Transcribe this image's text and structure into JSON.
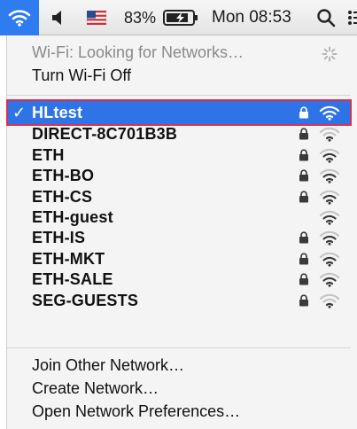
{
  "menubar": {
    "wifi_icon": "wifi-icon",
    "sound_icon": "speaker-icon",
    "flag_icon": "us-flag-icon",
    "battery_percent": "83%",
    "battery_icon": "battery-charging-icon",
    "clock": "Mon 08:53",
    "search_icon": "magnifier-icon",
    "notification_icon": "list-icon",
    "colors": {
      "wifi_active_bg": "#2f7bf0"
    }
  },
  "menu": {
    "status": "Wi-Fi: Looking for Networks…",
    "toggle": "Turn Wi-Fi Off",
    "networks": [
      {
        "name": "HLtest",
        "selected": true,
        "locked": true,
        "signal_bars": 4
      },
      {
        "name": "DIRECT-8C701B3B",
        "selected": false,
        "locked": true,
        "signal_bars": 2
      },
      {
        "name": "ETH",
        "selected": false,
        "locked": true,
        "signal_bars": 3
      },
      {
        "name": "ETH-BO",
        "selected": false,
        "locked": true,
        "signal_bars": 3
      },
      {
        "name": "ETH-CS",
        "selected": false,
        "locked": true,
        "signal_bars": 3
      },
      {
        "name": "ETH-guest",
        "selected": false,
        "locked": false,
        "signal_bars": 3
      },
      {
        "name": "ETH-IS",
        "selected": false,
        "locked": true,
        "signal_bars": 3
      },
      {
        "name": "ETH-MKT",
        "selected": false,
        "locked": true,
        "signal_bars": 3
      },
      {
        "name": "ETH-SALE",
        "selected": false,
        "locked": true,
        "signal_bars": 3
      },
      {
        "name": "SEG-GUESTS",
        "selected": false,
        "locked": true,
        "signal_bars": 2
      }
    ],
    "check_mark": "✓",
    "actions": {
      "join_other": "Join Other Network…",
      "create": "Create Network…",
      "preferences": "Open Network Preferences…"
    },
    "colors": {
      "selection_bg": "#2f74e6",
      "selection_outline": "#d8324a"
    }
  }
}
